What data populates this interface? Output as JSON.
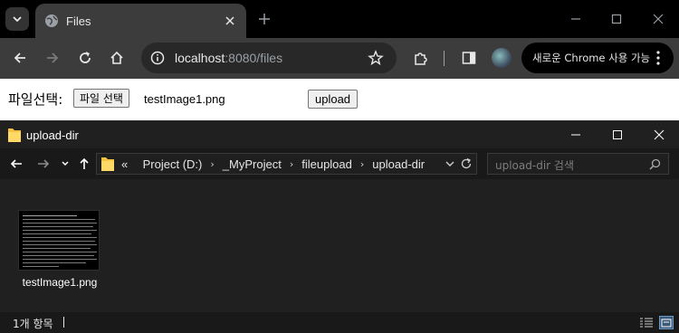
{
  "browser": {
    "tab_title": "Files",
    "url_host": "localhost",
    "url_rest": ":8080/files",
    "chrome_promo": "새로운 Chrome 사용 가능"
  },
  "page": {
    "file_label": "파일선택:",
    "file_button": "파일 선택",
    "file_name": "testImage1.png",
    "upload_button": "upload"
  },
  "explorer": {
    "title": "upload-dir",
    "breadcrumb_overflow": "«",
    "breadcrumbs": [
      "Project (D:)",
      "_MyProject",
      "fileupload",
      "upload-dir"
    ],
    "search_placeholder": "upload-dir 검색",
    "files": [
      {
        "name": "testImage1.png"
      }
    ],
    "status_count": "1개 항목"
  },
  "colors": {
    "chrome_dark": "#3c3c3c",
    "folder_yellow": "#f6c342",
    "explorer_bg": "#202020"
  }
}
